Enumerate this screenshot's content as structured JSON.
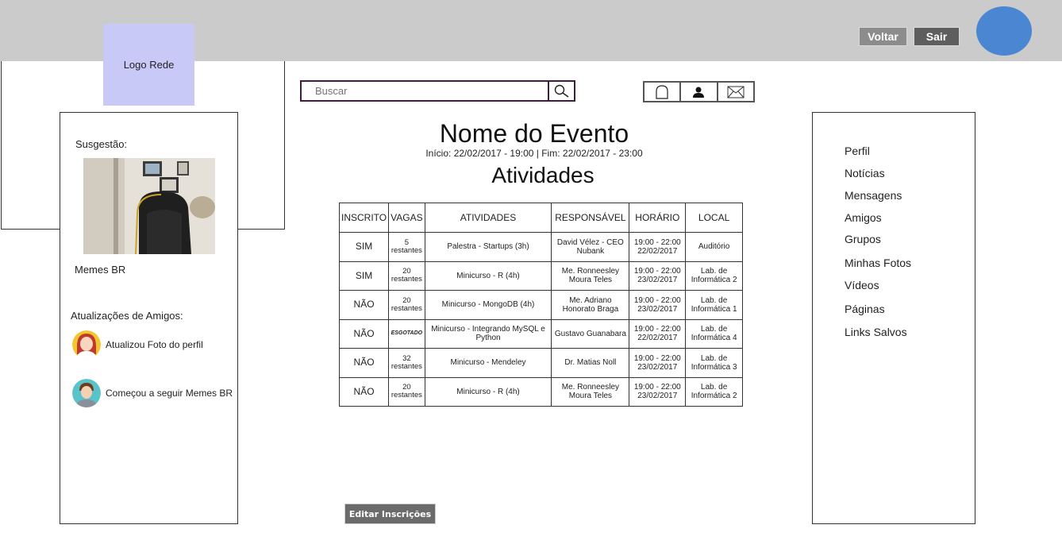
{
  "header": {
    "back_label": "Voltar",
    "exit_label": "Sair",
    "logo_text": "Logo Rede"
  },
  "search": {
    "placeholder": "Buscar"
  },
  "event": {
    "title": "Nome do Evento",
    "dates": "Início: 22/02/2017 - 19:00 | Fim: 22/02/2017 - 23:00",
    "section_title": "Atividades"
  },
  "table": {
    "headers": [
      "INSCRITO",
      "VAGAS",
      "ATIVIDADES",
      "RESPONSÁVEL",
      "HORÁRIO",
      "LOCAL"
    ],
    "rows": [
      {
        "inscrito": "SIM",
        "vagas": "5 restantes",
        "atividade": "Palestra - Startups (3h)",
        "responsavel": "David Vélez - CEO Nubank",
        "horario": "19:00 - 22:00 22/02/2017",
        "local": "Auditório"
      },
      {
        "inscrito": "SIM",
        "vagas": "20 restantes",
        "atividade": "Minicurso - R (4h)",
        "responsavel": "Me. Ronneesley Moura Teles",
        "horario": "19:00 - 22:00 23/02/2017",
        "local": "Lab. de Informática 2"
      },
      {
        "inscrito": "NÃO",
        "vagas": "20 restantes",
        "atividade": "Minicurso - MongoDB (4h)",
        "responsavel": "Me. Adriano Honorato Braga",
        "horario": "19:00 - 22:00 23/02/2017",
        "local": "Lab. de Informática 1"
      },
      {
        "inscrito": "NÃO",
        "vagas": "ESGOTADO",
        "atividade": "Minicurso - Integrando MySQL e Python",
        "responsavel": "Gustavo Guanabara",
        "horario": "19:00 - 22:00 22/02/2017",
        "local": "Lab. de Informática 4"
      },
      {
        "inscrito": "NÃO",
        "vagas": "32 restantes",
        "atividade": "Minicurso - Mendeley",
        "responsavel": "Dr. Matias Noll",
        "horario": "19:00 - 22:00 23/02/2017",
        "local": "Lab. de Informática 3"
      },
      {
        "inscrito": "NÃO",
        "vagas": "20 restantes",
        "atividade": "Minicurso - R (4h)",
        "responsavel": "Me. Ronneesley Moura Teles",
        "horario": "19:00 - 22:00 23/02/2017",
        "local": "Lab. de Informática 2"
      }
    ]
  },
  "left_panel": {
    "suggestion_label": "Susgestão:",
    "suggestion_name": "Memes BR",
    "updates_label": "Atualizações de Amigos:",
    "updates": [
      {
        "text": "Atualizou Foto do perfil"
      },
      {
        "text": "Começou a seguir Memes BR"
      }
    ]
  },
  "right_menu": {
    "items": [
      "Perfil",
      "Notícias",
      "Mensagens",
      "Amigos",
      "Grupos",
      "Minhas Fotos",
      "Vídeos",
      "Páginas",
      "Links Salvos"
    ]
  },
  "actions": {
    "edit_label": "Editar Inscrições"
  },
  "icons": {
    "search": "search-icon",
    "notifications": "bell-icon",
    "profile": "user-icon",
    "messages": "envelope-icon"
  },
  "colors": {
    "topbar": "#cbcbcb",
    "logo_bg": "#c9c9f8",
    "avatar": "#4a86d1",
    "back_button": "#8c8c8c",
    "exit_button": "#5e5e5e",
    "edit_button": "#6b6b6b"
  }
}
